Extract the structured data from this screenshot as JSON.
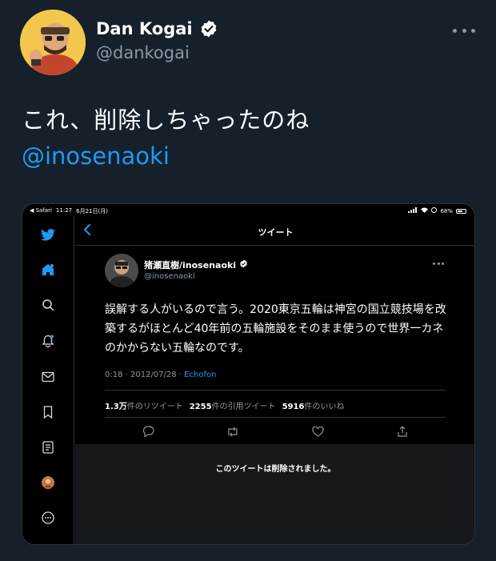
{
  "author": {
    "name": "Dan Kogai",
    "handle": "@dankogai"
  },
  "tweet": {
    "text": "これ、削除しちゃったのね",
    "mention": "@inosenaoki"
  },
  "screenshot": {
    "status_bar": {
      "left": [
        "◀ Safari",
        "11:27",
        "6月21日(月)"
      ],
      "battery": "68%",
      "battery_level": 0.68
    },
    "title": "ツイート",
    "inner_tweet": {
      "name": "猪瀬直樹/inosenaoki",
      "handle": "@inosenaoki",
      "text": "誤解する人がいるので言う。2020東京五輪は神宮の国立競技場を改築するがほとんど40年前の五輪施設をそのまま使うので世界一カネのかからない五輪なのです。",
      "time": "0:18 · 2012/07/28 · ",
      "source": "Echofon",
      "stats": [
        {
          "count": "1.3万",
          "label": "件のリツイート"
        },
        {
          "count": "2255",
          "label": "件の引用ツイート"
        },
        {
          "count": "5916",
          "label": "件のいいね"
        }
      ]
    },
    "deleted_notice": "このツイートは削除されました。"
  },
  "colors": {
    "background": "#15202b",
    "accent": "#1d9bf0",
    "secondary_text": "#8b98a5"
  }
}
